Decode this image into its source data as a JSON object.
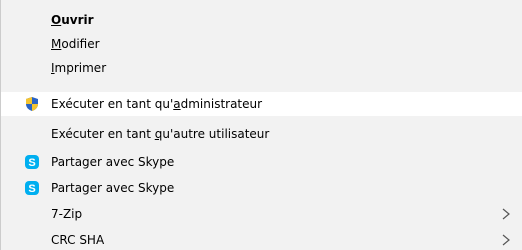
{
  "menu": {
    "items": [
      {
        "pre": "",
        "ul": "O",
        "post": "uvrir",
        "bold": true
      },
      {
        "pre": "",
        "ul": "M",
        "post": "odifier"
      },
      {
        "pre": "",
        "ul": "I",
        "post": "mprimer"
      },
      {
        "pre": "Exécuter en tant qu'",
        "ul": "a",
        "post": "dministrateur",
        "icon": "uac-shield-icon"
      },
      {
        "pre": "Exécuter en tant ",
        "ul": "q",
        "post": "u'autre utilisateur"
      },
      {
        "pre": "Partager avec Skype",
        "ul": "",
        "post": "",
        "icon": "skype-icon"
      },
      {
        "pre": "Partager avec Skype",
        "ul": "",
        "post": "",
        "icon": "skype-icon"
      },
      {
        "pre": "7-Zip",
        "ul": "",
        "post": "",
        "submenu": true
      },
      {
        "pre": "CRC SHA",
        "ul": "",
        "post": "",
        "submenu": true
      }
    ]
  },
  "colors": {
    "menu_bg": "#f2f2f2",
    "highlight_bg": "#ffffff",
    "skype_blue": "#00aff0",
    "shield_blue": "#2a63c4",
    "shield_yellow": "#f4c430"
  }
}
